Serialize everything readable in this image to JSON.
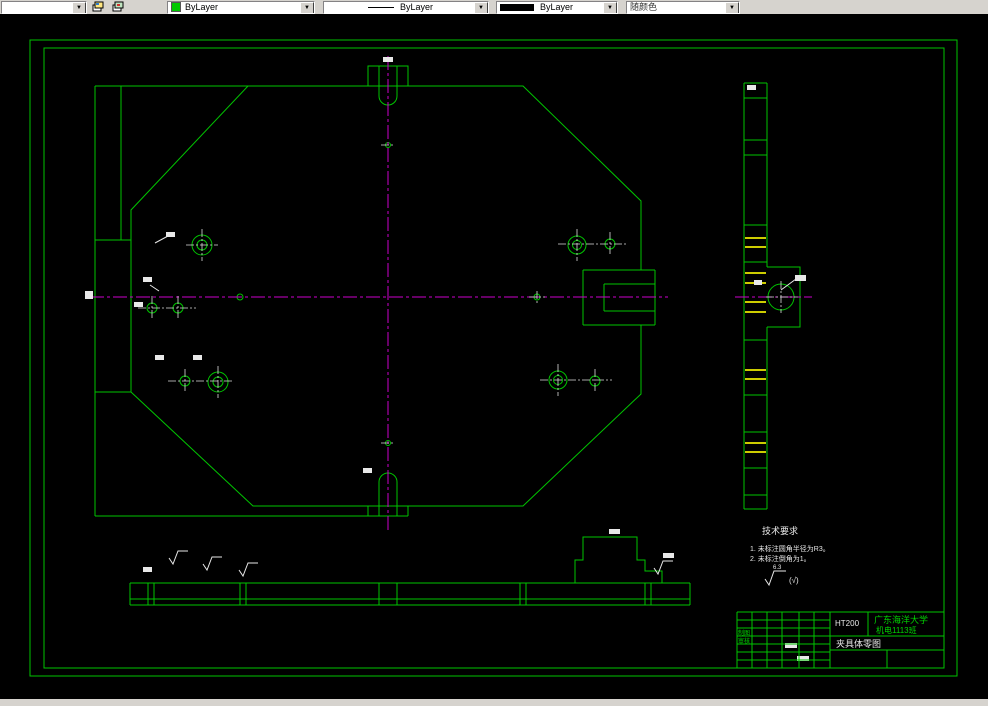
{
  "toolbar": {
    "color_value": "ByLayer",
    "linetype_value": "ByLayer",
    "lineweight_value": "ByLayer",
    "plotstyle_value": "随颜色"
  },
  "icons": {
    "dropdown_arrow": "▼"
  },
  "tech_req": {
    "title": "技术要求",
    "line1": "1. 未标注圆角半径为R3。",
    "line2": "2. 未标注倒角为1。",
    "roughness_value": "6.3",
    "roughness_rest": "(√)"
  },
  "title_block": {
    "school": "广东海洋大学",
    "class_name": "机电1113班",
    "material": "HT200",
    "part_name": "夹具体零图",
    "cell1": "制图",
    "cell2": "审核"
  },
  "colors": {
    "cad_green": "#00c400",
    "cad_magenta": "#cc00cc",
    "cad_yellow": "#cccc00",
    "dim_white": "#e8e8e8",
    "toolbar_bg": "#d6d3ce"
  }
}
